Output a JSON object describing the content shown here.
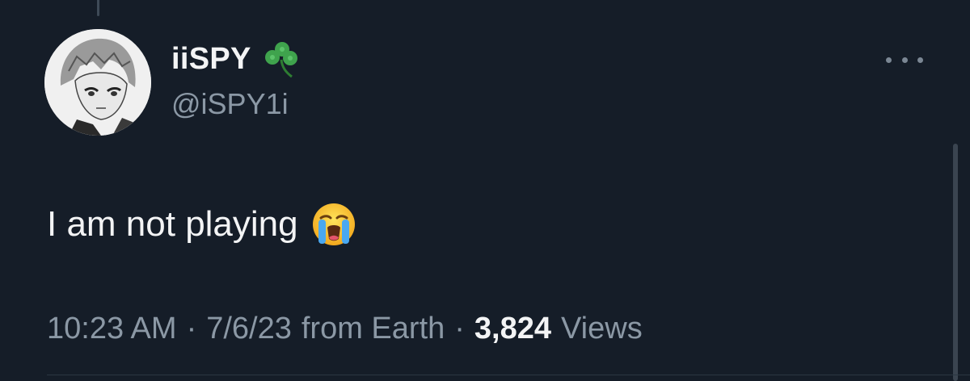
{
  "tweet": {
    "author": {
      "display_name": "iiSPY",
      "badge_icon": "shamrock-icon",
      "handle": "@iSPY1i",
      "avatar": "anime-character-avatar"
    },
    "text": "I am not playing",
    "text_emoji": "loudly-crying-face-icon",
    "time": "10:23 AM",
    "separator": "·",
    "date": "7/6/23",
    "source": "from Earth",
    "views_count": "3,824",
    "views_label": "Views"
  },
  "colors": {
    "background": "#151d28",
    "primary_text": "#f3f4f5",
    "secondary_text": "#8b98a5"
  },
  "icons": {
    "more": "more-options-icon"
  }
}
